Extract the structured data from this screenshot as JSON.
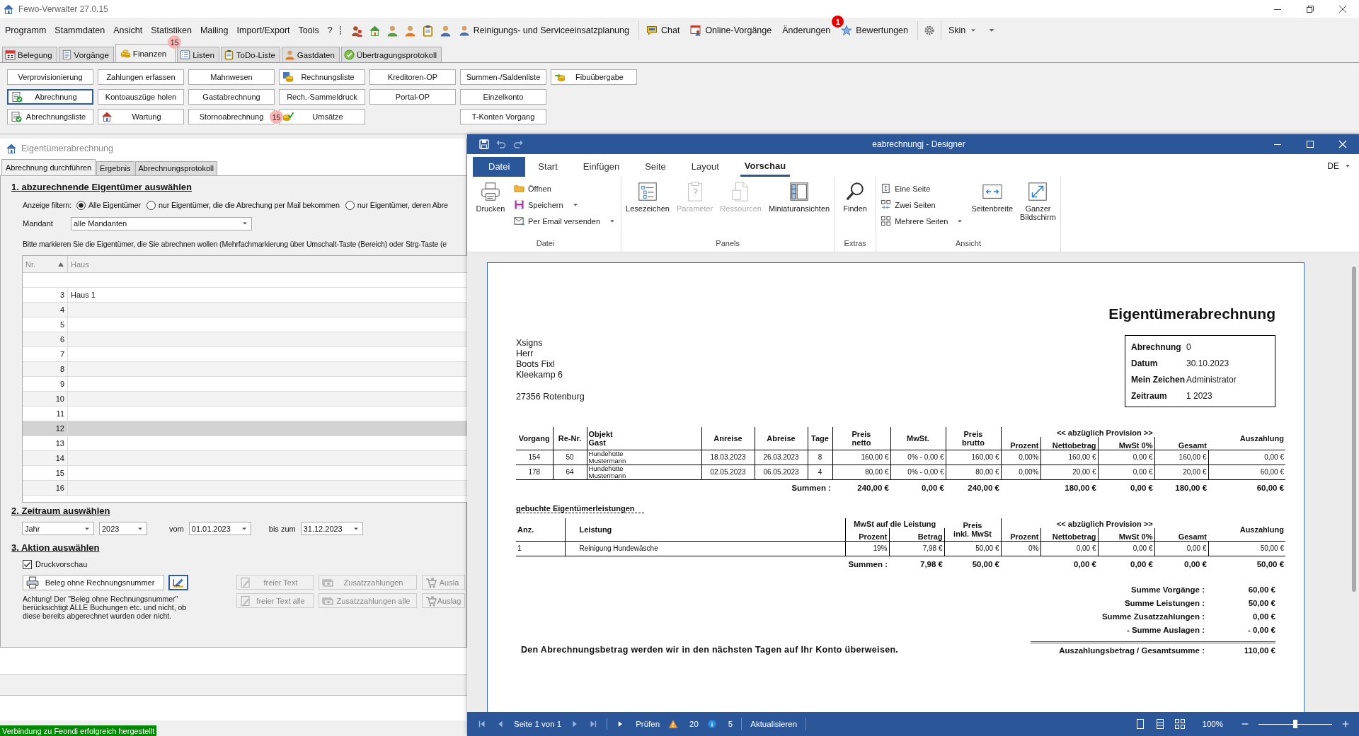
{
  "window": {
    "title": "Fewo-Verwalter 27.0.15"
  },
  "menu": [
    "Programm",
    "Stammdaten",
    "Ansicht",
    "Statistiken",
    "Mailing",
    "Import/Export",
    "Tools",
    "?"
  ],
  "toolbar": [
    {
      "label": "Reinigungs- und Serviceeinsatzplanung"
    },
    {
      "label": "Chat"
    },
    {
      "label": "Online-Vorgänge"
    },
    {
      "label": "Änderungen",
      "badge": "1"
    },
    {
      "label": "Bewertungen"
    }
  ],
  "skin": "Skin",
  "module_tabs": [
    {
      "label": "Belegung",
      "selected": false
    },
    {
      "label": "Vorgänge",
      "selected": false
    },
    {
      "label": "Finanzen",
      "selected": true,
      "badge": "15"
    },
    {
      "label": "Listen",
      "selected": false
    },
    {
      "label": "ToDo-Liste",
      "selected": false
    },
    {
      "label": "Gastdaten",
      "selected": false
    },
    {
      "label": "Übertragungsprotokoll",
      "selected": false
    }
  ],
  "function_buttons": [
    [
      {
        "label": "Verprovisionierung",
        "focused": false
      },
      {
        "label": "Abrechnung",
        "focused": true
      },
      {
        "label": "Abrechnungsliste",
        "focused": false
      }
    ],
    [
      {
        "label": "Zahlungen erfassen",
        "focused": false
      },
      {
        "label": "Kontoauszüge holen",
        "focused": false
      },
      {
        "label": "Wartung",
        "focused": false
      }
    ],
    [
      {
        "label": "Mahnwesen",
        "focused": false
      },
      {
        "label": "Gastabrechnung",
        "focused": false
      },
      {
        "label": "Stornoabrechnung",
        "focused": false,
        "badge": "15"
      }
    ],
    [
      {
        "label": "Rechnungsliste",
        "focused": false
      },
      {
        "label": "Rech.-Sammeldruck",
        "focused": false
      },
      {
        "label": "Umsätze",
        "focused": false
      }
    ],
    [
      {
        "label": "Kreditoren-OP",
        "focused": false
      },
      {
        "label": "Portal-OP",
        "focused": false
      }
    ],
    [
      {
        "label": "Summen-/Saldenliste",
        "focused": false
      },
      {
        "label": "Einzelkonto",
        "focused": false
      },
      {
        "label": "T-Konten Vorgang",
        "focused": false
      }
    ],
    [
      {
        "label": "Fibuübergabe",
        "focused": false
      }
    ]
  ],
  "owner_billing": {
    "title": "Eigentümerabrechnung",
    "tabs": [
      {
        "label": "Abrechnung durchführen",
        "selected": true
      },
      {
        "label": "Ergebnis",
        "selected": false
      },
      {
        "label": "Abrechnungsprotokoll",
        "selected": false
      }
    ],
    "select_owners": {
      "heading": "1. abzurechnende Eigentümer auswählen",
      "filter_label": "Anzeige filtern:",
      "filter_options": [
        {
          "label": "Alle Eigentümer",
          "selected": true
        },
        {
          "label": "nur Eigentümer, die die Abrechung per Mail bekommen",
          "selected": false
        },
        {
          "label": "nur Eigentümer, deren Abre",
          "selected": false
        }
      ],
      "client_label": "Mandant",
      "client_value": "alle Mandanten",
      "instruction": "Bitte markieren Sie die Eigentümer, die Sie abrechnen wollen (Mehrfachmarkierung über Umschalt-Taste (Bereich) oder Strg-Taste (e",
      "grid": {
        "columns": [
          {
            "label": "Nr.",
            "sorted": true
          },
          {
            "label": "Haus",
            "sorted": false
          }
        ],
        "rows": [
          {
            "nr": "3",
            "haus": "Haus 1",
            "selected": false
          },
          {
            "nr": "4",
            "selected": false
          },
          {
            "nr": "5",
            "selected": false
          },
          {
            "nr": "6",
            "selected": false
          },
          {
            "nr": "7",
            "selected": false
          },
          {
            "nr": "8",
            "selected": false
          },
          {
            "nr": "9",
            "selected": false
          },
          {
            "nr": "10",
            "selected": false
          },
          {
            "nr": "11",
            "selected": false
          },
          {
            "nr": "12",
            "selected": true
          },
          {
            "nr": "13",
            "selected": false
          },
          {
            "nr": "14",
            "selected": false
          },
          {
            "nr": "15",
            "selected": false
          },
          {
            "nr": "16",
            "selected": false
          }
        ]
      }
    },
    "period": {
      "heading": "2. Zeitraum auswählen",
      "unit": "Jahr",
      "year": "2023",
      "from_label": "vom",
      "from": "01.01.2023",
      "to_label": "bis zum",
      "to": "31.12.2023"
    },
    "action": {
      "heading": "3. Aktion auswählen",
      "preview": {
        "label": "Druckvorschau",
        "checked": true
      },
      "receipt_button": "Beleg ohne Rechnungsnummer",
      "note": "Achtung! Der \"Beleg ohne Rechnungsnummer\" berücksichtigt ALLE Buchungen etc. und nicht, ob diese bereits abgerechnet wurden oder nicht.",
      "buttons": [
        [
          {
            "label": "freier Text",
            "disabled": true
          },
          {
            "label": "Zusatzzahlungen",
            "disabled": true
          },
          {
            "label": "Ausla",
            "disabled": true
          }
        ],
        [
          {
            "label": "freier Text alle",
            "disabled": true
          },
          {
            "label": "Zusatzzahlungen alle",
            "disabled": true
          },
          {
            "label": "Auslag",
            "disabled": true
          }
        ]
      ]
    }
  },
  "status_bar": "Verbindung zu Feondi erfolgreich hergestellt",
  "designer": {
    "title": "eabrechnungj - Designer",
    "ribbon_tabs": [
      {
        "label": "Datei",
        "kind": "file",
        "selected": false
      },
      {
        "label": "Start",
        "kind": "tab",
        "selected": false
      },
      {
        "label": "Einfügen",
        "kind": "tab",
        "selected": false
      },
      {
        "label": "Seite",
        "kind": "tab",
        "selected": false
      },
      {
        "label": "Layout",
        "kind": "tab",
        "selected": false
      },
      {
        "label": "Vorschau",
        "kind": "tab",
        "selected": true
      }
    ],
    "language": "DE",
    "groups": [
      {
        "label": "Datei",
        "items": [
          {
            "label": "Drucken",
            "kind": "large",
            "disabled": false,
            "dropdown": false
          },
          {
            "label": "Öffnen",
            "kind": "small",
            "disabled": false,
            "dropdown": false
          },
          {
            "label": "Speichern",
            "kind": "small",
            "disabled": false,
            "dropdown": true
          },
          {
            "label": "Per Email versenden",
            "kind": "small",
            "disabled": false,
            "dropdown": true
          }
        ]
      },
      {
        "label": "Panels",
        "items": [
          {
            "label": "Lesezeichen",
            "kind": "large",
            "disabled": false,
            "dropdown": false
          },
          {
            "label": "Parameter",
            "kind": "large",
            "disabled": true,
            "dropdown": false
          },
          {
            "label": "Ressourcen",
            "kind": "large",
            "disabled": true,
            "dropdown": false
          },
          {
            "label": "Miniaturansichten",
            "kind": "large",
            "disabled": false,
            "dropdown": false
          }
        ]
      },
      {
        "label": "Extras",
        "items": [
          {
            "label": "Finden",
            "kind": "large",
            "disabled": false,
            "dropdown": false
          }
        ]
      },
      {
        "label": "Ansicht",
        "items": [
          {
            "label": "Eine Seite",
            "kind": "small",
            "disabled": false,
            "dropdown": false
          },
          {
            "label": "Zwei Seiten",
            "kind": "small",
            "disabled": false,
            "dropdown": false
          },
          {
            "label": "Mehrere Seiten",
            "kind": "small",
            "disabled": false,
            "dropdown": true
          },
          {
            "label": "Seitenbreite",
            "kind": "large",
            "disabled": false,
            "dropdown": false
          },
          {
            "label": "Ganzer Bildschirm",
            "kind": "large",
            "disabled": false,
            "dropdown": false
          }
        ]
      }
    ],
    "document": {
      "title": "Eigentümerabrechnung",
      "address": [
        "Xsigns",
        "Herr",
        "Boots Fixl",
        "Kleekamp 6"
      ],
      "city": "27356 Rotenburg",
      "info": [
        {
          "label": "Abrechnung",
          "value": "0"
        },
        {
          "label": "Datum",
          "value": "30.10.2023"
        },
        {
          "label": "Mein Zeichen",
          "value": "Administrator"
        },
        {
          "label": "Zeitraum",
          "value": "1 2023"
        }
      ],
      "bookings": {
        "columns": [
          {
            "label": [
              "Vorgang"
            ],
            "kind": "center"
          },
          {
            "label": [
              "Re-Nr."
            ],
            "kind": "center"
          },
          {
            "label": [
              "Objekt",
              "Gast"
            ],
            "kind": "text"
          },
          {
            "label": [
              "Anreise"
            ],
            "kind": "center"
          },
          {
            "label": [
              "Abreise"
            ],
            "kind": "center"
          },
          {
            "label": [
              "Tage"
            ],
            "kind": "center"
          },
          {
            "label": [
              "Preis",
              "netto"
            ],
            "kind": "number"
          },
          {
            "label": [
              "MwSt."
            ],
            "kind": "number"
          },
          {
            "label": [
              "Preis",
              "brutto"
            ],
            "kind": "number"
          },
          {
            "group": "<< abzüglich Provision >>",
            "colspan": 4,
            "columns": [
              {
                "label": [
                  "Prozent"
                ],
                "kind": "number"
              },
              {
                "label": [
                  "Nettobetrag"
                ],
                "kind": "number"
              },
              {
                "label": [
                  "MwSt 0%"
                ],
                "kind": "number"
              },
              {
                "label": [
                  "Gesamt"
                ],
                "kind": "number"
              }
            ]
          },
          {
            "label": [
              "Auszahlung"
            ],
            "kind": "number"
          }
        ],
        "rows": [
          [
            "154",
            "50",
            [
              "Hundehütte",
              "Mustermann"
            ],
            "18.03.2023",
            "26.03.2023",
            "8",
            "160,00 €",
            "0% - 0,00 €",
            "160,00 €",
            "0,00%",
            "160,00 €",
            "0,00 €",
            "160,00 €",
            "0,00 €"
          ],
          [
            "178",
            "64",
            [
              "Hundehütte",
              "Mustermann"
            ],
            "02.05.2023",
            "06.05.2023",
            "4",
            "80,00 €",
            "0% - 0,00 €",
            "80,00 €",
            "0,00%",
            "20,00 €",
            "0,00 €",
            "20,00 €",
            "60,00 €"
          ]
        ],
        "sums": {
          "label": "Summen :",
          "values": [
            "240,00 €",
            "0,00 €",
            "240,00 €",
            "180,00 €",
            "0,00 €",
            "180,00 €",
            "60,00 €"
          ]
        }
      },
      "services": {
        "heading": "gebuchte Eigentümerleistungen",
        "columns": [
          {
            "label": [
              "Anz."
            ],
            "kind": "text"
          },
          {
            "label": [
              "Leistung"
            ],
            "kind": "text"
          },
          {
            "group": "MwSt auf die Leistung",
            "colspan": 2,
            "columns": [
              {
                "label": [
                  "Prozent"
                ],
                "kind": "number"
              },
              {
                "label": [
                  "Betrag"
                ],
                "kind": "number"
              }
            ]
          },
          {
            "label": [
              "Preis",
              "inkl. MwSt"
            ],
            "kind": "number"
          },
          {
            "group": "<< abzüglich Provision >>",
            "colspan": 4,
            "columns": [
              {
                "label": [
                  "Prozent"
                ],
                "kind": "number"
              },
              {
                "label": [
                  "Nettobetrag"
                ],
                "kind": "number"
              },
              {
                "label": [
                  "MwSt 0%"
                ],
                "kind": "number"
              },
              {
                "label": [
                  "Gesamt"
                ],
                "kind": "number"
              }
            ]
          },
          {
            "label": [
              "Auszahlung"
            ],
            "kind": "number"
          }
        ],
        "rows": [
          [
            "1",
            "Reinigung Hundewäsche",
            "19%",
            "7,98 €",
            "50,00 €",
            "0%",
            "0,00 €",
            "0,00 €",
            "0,00 €",
            "50,00 €"
          ]
        ],
        "sums": {
          "label": "Summen :",
          "values": [
            "7,98 €",
            "50,00 €",
            "0,00 €",
            "0,00 €",
            "0,00 €",
            "50,00 €"
          ]
        }
      },
      "totals": [
        {
          "label": "Summe Vorgänge :",
          "value": "60,00 €"
        },
        {
          "label": "Summe Leistungen :",
          "value": "50,00 €"
        },
        {
          "label": "Summe Zusatzzahlungen :",
          "value": "0,00 €"
        },
        {
          "label": "- Summe Auslagen :",
          "value": "- 0,00 €"
        }
      ],
      "closing": "Den Abrechnungsbetrag werden wir in den nächsten Tagen auf Ihr Konto überweisen.",
      "grand_total": {
        "label": "Auszahlungsbetrag / Gesamtsumme :",
        "value": "110,00 €"
      }
    },
    "status": {
      "page": "Seite 1 von 1",
      "check": "Prüfen",
      "warnings": "20",
      "infos": "5",
      "refresh": "Aktualisieren",
      "zoom": "100%",
      "zoom_slider": {
        "level": 0.5
      }
    }
  }
}
